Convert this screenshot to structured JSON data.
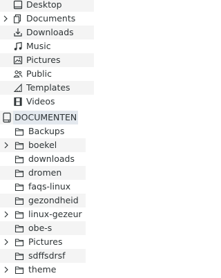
{
  "places": {
    "desktop": "Desktop",
    "documents": "Documents",
    "downloads": "Downloads",
    "music": "Music",
    "pictures": "Pictures",
    "public": "Public",
    "templates": "Templates",
    "videos": "Videos"
  },
  "drive": {
    "label": "DOCUMENTEN"
  },
  "folders": {
    "backups": "Backups",
    "boekel": "boekel",
    "downloads": "downloads",
    "dromen": "dromen",
    "faqs_linux": "faqs-linux",
    "gezondheid": "gezondheid",
    "linux_gezeur": "linux-gezeur",
    "obe_s": "obe-s",
    "pictures": "Pictures",
    "sdffsdrsf": "sdffsdrsf",
    "theme": "theme"
  },
  "colors": {
    "selected_bg": "#e3e8ee",
    "stripe_bg": "#f4f4f4",
    "text": "#2e3436",
    "icon": "#2e3436"
  }
}
